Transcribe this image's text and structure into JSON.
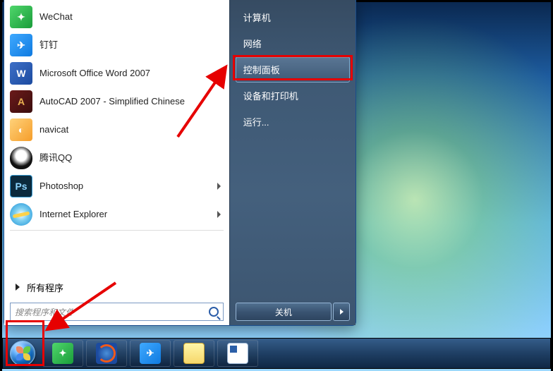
{
  "left_panel": {
    "programs": [
      {
        "label": "WeChat",
        "icon": "wechat-icon",
        "has_submenu": false
      },
      {
        "label": "钉钉",
        "icon": "dingtalk-icon",
        "has_submenu": false
      },
      {
        "label": "Microsoft Office Word 2007",
        "icon": "word-icon",
        "has_submenu": true
      },
      {
        "label": "AutoCAD 2007 - Simplified Chinese",
        "icon": "autocad-icon",
        "has_submenu": false
      },
      {
        "label": "navicat",
        "icon": "navicat-icon",
        "has_submenu": false
      },
      {
        "label": "腾讯QQ",
        "icon": "qq-icon",
        "has_submenu": false
      },
      {
        "label": "Photoshop",
        "icon": "photoshop-icon",
        "has_submenu": true
      },
      {
        "label": "Internet Explorer",
        "icon": "ie-icon",
        "has_submenu": true
      }
    ],
    "all_programs": "所有程序",
    "search_placeholder": "搜索程序和文件"
  },
  "right_panel": {
    "items": [
      {
        "label": "计算机",
        "highlight": false
      },
      {
        "label": "网络",
        "highlight": false
      },
      {
        "label": "控制面板",
        "highlight": true
      },
      {
        "label": "设备和打印机",
        "highlight": false
      },
      {
        "label": "运行...",
        "highlight": false
      }
    ],
    "shutdown_label": "关机"
  },
  "taskbar": {
    "buttons": [
      {
        "name": "taskbar-wechat",
        "icon": "wechat-icon"
      },
      {
        "name": "taskbar-firefox",
        "icon": "firefox-icon"
      },
      {
        "name": "taskbar-dingtalk",
        "icon": "dingtalk-icon"
      },
      {
        "name": "taskbar-explorer",
        "icon": "folder-icon"
      },
      {
        "name": "taskbar-word-doc",
        "icon": "doc-icon"
      }
    ]
  },
  "icon_glyphs": {
    "wechat-icon": "✦",
    "dingtalk-icon": "✈",
    "word-icon": "W",
    "autocad-icon": "A",
    "navicat-icon": "◐",
    "qq-icon": "",
    "photoshop-icon": "Ps",
    "ie-icon": "",
    "firefox-icon": "",
    "folder-icon": "",
    "doc-icon": ""
  },
  "annotation": {
    "highlight_boxes": [
      "control-panel-box",
      "start-button-box"
    ]
  }
}
